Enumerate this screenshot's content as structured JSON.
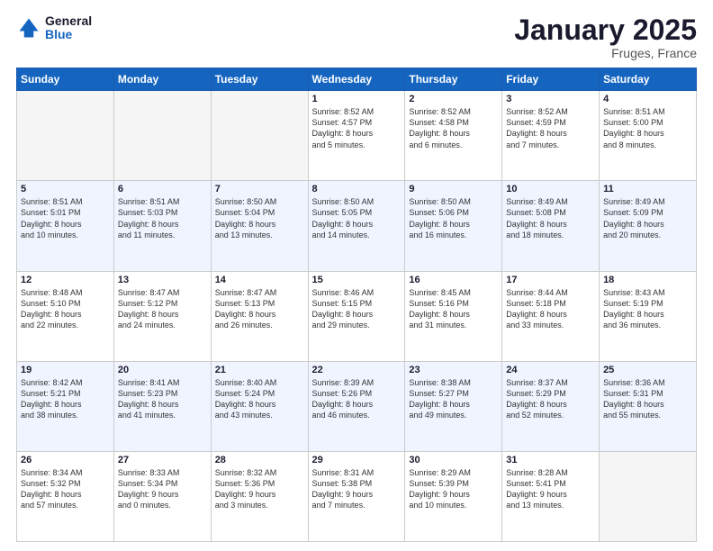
{
  "logo": {
    "general": "General",
    "blue": "Blue"
  },
  "header": {
    "month": "January 2025",
    "location": "Fruges, France"
  },
  "weekdays": [
    "Sunday",
    "Monday",
    "Tuesday",
    "Wednesday",
    "Thursday",
    "Friday",
    "Saturday"
  ],
  "weeks": [
    [
      {
        "day": "",
        "info": ""
      },
      {
        "day": "",
        "info": ""
      },
      {
        "day": "",
        "info": ""
      },
      {
        "day": "1",
        "info": "Sunrise: 8:52 AM\nSunset: 4:57 PM\nDaylight: 8 hours\nand 5 minutes."
      },
      {
        "day": "2",
        "info": "Sunrise: 8:52 AM\nSunset: 4:58 PM\nDaylight: 8 hours\nand 6 minutes."
      },
      {
        "day": "3",
        "info": "Sunrise: 8:52 AM\nSunset: 4:59 PM\nDaylight: 8 hours\nand 7 minutes."
      },
      {
        "day": "4",
        "info": "Sunrise: 8:51 AM\nSunset: 5:00 PM\nDaylight: 8 hours\nand 8 minutes."
      }
    ],
    [
      {
        "day": "5",
        "info": "Sunrise: 8:51 AM\nSunset: 5:01 PM\nDaylight: 8 hours\nand 10 minutes."
      },
      {
        "day": "6",
        "info": "Sunrise: 8:51 AM\nSunset: 5:03 PM\nDaylight: 8 hours\nand 11 minutes."
      },
      {
        "day": "7",
        "info": "Sunrise: 8:50 AM\nSunset: 5:04 PM\nDaylight: 8 hours\nand 13 minutes."
      },
      {
        "day": "8",
        "info": "Sunrise: 8:50 AM\nSunset: 5:05 PM\nDaylight: 8 hours\nand 14 minutes."
      },
      {
        "day": "9",
        "info": "Sunrise: 8:50 AM\nSunset: 5:06 PM\nDaylight: 8 hours\nand 16 minutes."
      },
      {
        "day": "10",
        "info": "Sunrise: 8:49 AM\nSunset: 5:08 PM\nDaylight: 8 hours\nand 18 minutes."
      },
      {
        "day": "11",
        "info": "Sunrise: 8:49 AM\nSunset: 5:09 PM\nDaylight: 8 hours\nand 20 minutes."
      }
    ],
    [
      {
        "day": "12",
        "info": "Sunrise: 8:48 AM\nSunset: 5:10 PM\nDaylight: 8 hours\nand 22 minutes."
      },
      {
        "day": "13",
        "info": "Sunrise: 8:47 AM\nSunset: 5:12 PM\nDaylight: 8 hours\nand 24 minutes."
      },
      {
        "day": "14",
        "info": "Sunrise: 8:47 AM\nSunset: 5:13 PM\nDaylight: 8 hours\nand 26 minutes."
      },
      {
        "day": "15",
        "info": "Sunrise: 8:46 AM\nSunset: 5:15 PM\nDaylight: 8 hours\nand 29 minutes."
      },
      {
        "day": "16",
        "info": "Sunrise: 8:45 AM\nSunset: 5:16 PM\nDaylight: 8 hours\nand 31 minutes."
      },
      {
        "day": "17",
        "info": "Sunrise: 8:44 AM\nSunset: 5:18 PM\nDaylight: 8 hours\nand 33 minutes."
      },
      {
        "day": "18",
        "info": "Sunrise: 8:43 AM\nSunset: 5:19 PM\nDaylight: 8 hours\nand 36 minutes."
      }
    ],
    [
      {
        "day": "19",
        "info": "Sunrise: 8:42 AM\nSunset: 5:21 PM\nDaylight: 8 hours\nand 38 minutes."
      },
      {
        "day": "20",
        "info": "Sunrise: 8:41 AM\nSunset: 5:23 PM\nDaylight: 8 hours\nand 41 minutes."
      },
      {
        "day": "21",
        "info": "Sunrise: 8:40 AM\nSunset: 5:24 PM\nDaylight: 8 hours\nand 43 minutes."
      },
      {
        "day": "22",
        "info": "Sunrise: 8:39 AM\nSunset: 5:26 PM\nDaylight: 8 hours\nand 46 minutes."
      },
      {
        "day": "23",
        "info": "Sunrise: 8:38 AM\nSunset: 5:27 PM\nDaylight: 8 hours\nand 49 minutes."
      },
      {
        "day": "24",
        "info": "Sunrise: 8:37 AM\nSunset: 5:29 PM\nDaylight: 8 hours\nand 52 minutes."
      },
      {
        "day": "25",
        "info": "Sunrise: 8:36 AM\nSunset: 5:31 PM\nDaylight: 8 hours\nand 55 minutes."
      }
    ],
    [
      {
        "day": "26",
        "info": "Sunrise: 8:34 AM\nSunset: 5:32 PM\nDaylight: 8 hours\nand 57 minutes."
      },
      {
        "day": "27",
        "info": "Sunrise: 8:33 AM\nSunset: 5:34 PM\nDaylight: 9 hours\nand 0 minutes."
      },
      {
        "day": "28",
        "info": "Sunrise: 8:32 AM\nSunset: 5:36 PM\nDaylight: 9 hours\nand 3 minutes."
      },
      {
        "day": "29",
        "info": "Sunrise: 8:31 AM\nSunset: 5:38 PM\nDaylight: 9 hours\nand 7 minutes."
      },
      {
        "day": "30",
        "info": "Sunrise: 8:29 AM\nSunset: 5:39 PM\nDaylight: 9 hours\nand 10 minutes."
      },
      {
        "day": "31",
        "info": "Sunrise: 8:28 AM\nSunset: 5:41 PM\nDaylight: 9 hours\nand 13 minutes."
      },
      {
        "day": "",
        "info": ""
      }
    ]
  ]
}
